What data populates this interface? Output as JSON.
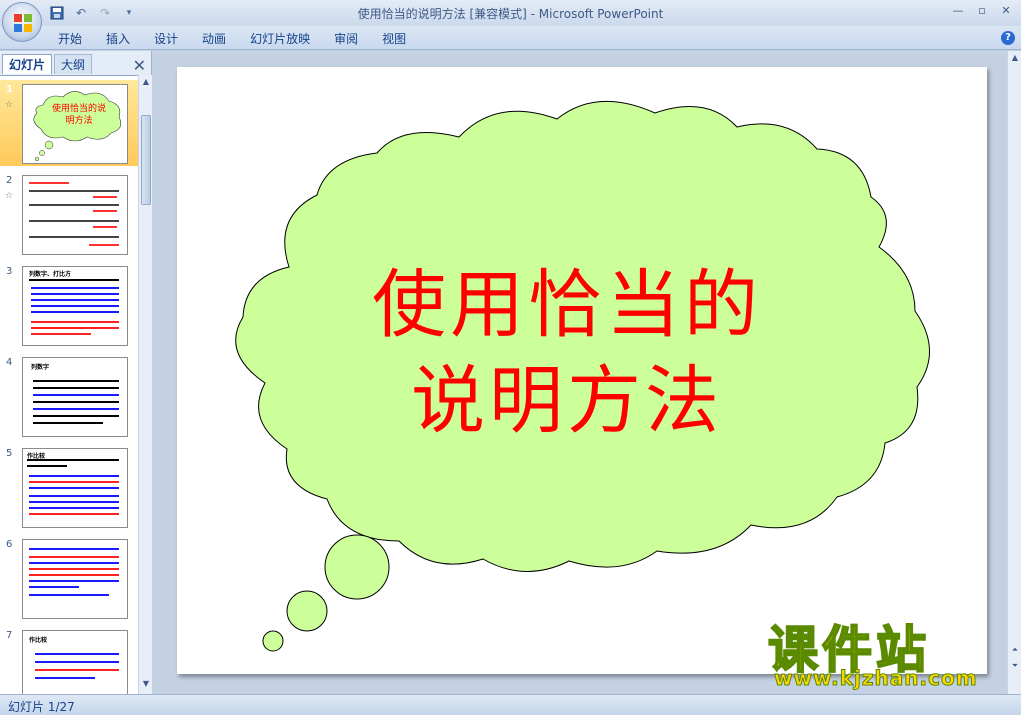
{
  "window": {
    "title": "使用恰当的说明方法 [兼容模式] - Microsoft PowerPoint"
  },
  "quick_access": {
    "save_icon": "save-icon",
    "undo_icon": "undo-icon",
    "redo_icon": "redo-icon",
    "customize_icon": "dropdown-icon"
  },
  "ribbon": {
    "tabs": [
      "开始",
      "插入",
      "设计",
      "动画",
      "幻灯片放映",
      "审阅",
      "视图"
    ],
    "help_label": "?"
  },
  "panel": {
    "tab_slides": "幻灯片",
    "tab_outline": "大纲",
    "close_label": "✕",
    "thumbnails": [
      {
        "number": "1",
        "label": "使用恰当的说明方法",
        "selected": true
      },
      {
        "number": "2",
        "selected": false
      },
      {
        "number": "3",
        "label": "列数字、打比方",
        "selected": false
      },
      {
        "number": "4",
        "label": "列数字",
        "selected": false
      },
      {
        "number": "5",
        "label": "作比较",
        "selected": false
      },
      {
        "number": "6",
        "selected": false
      },
      {
        "number": "7",
        "label": "作比较",
        "selected": false
      }
    ]
  },
  "slide": {
    "title_line1": "使用恰当的",
    "title_line2": "说明方法",
    "bubble_color": "#ccff99",
    "title_color": "#ff0000"
  },
  "watermark": {
    "cn": "课件站",
    "url": "www.kjzhan.com"
  },
  "status": {
    "slide_indicator": "幻灯片 1/27"
  }
}
